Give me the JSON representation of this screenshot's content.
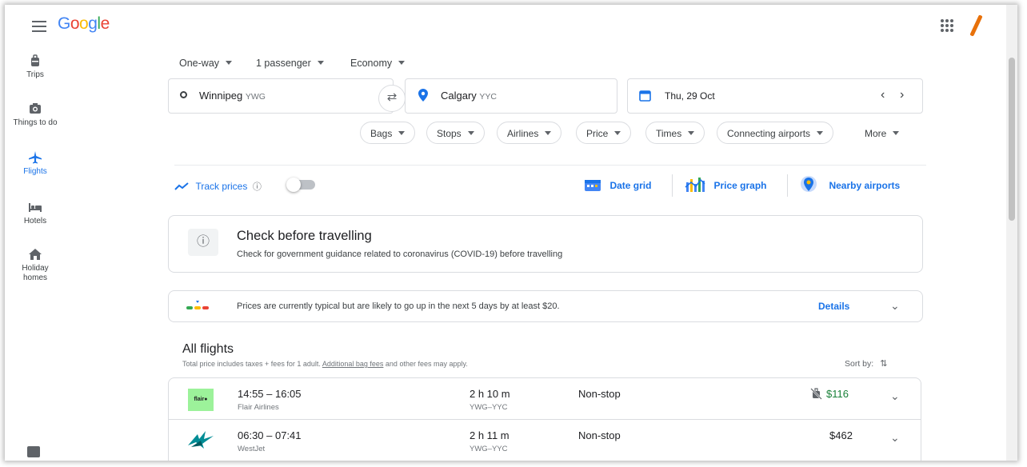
{
  "header": {
    "logo": "Google"
  },
  "sidebar": {
    "items": [
      {
        "label": "Trips",
        "icon": "trips-icon"
      },
      {
        "label": "Things to do",
        "icon": "camera-icon"
      },
      {
        "label": "Flights",
        "icon": "airplane-icon"
      },
      {
        "label": "Hotels",
        "icon": "bed-icon"
      },
      {
        "label": "Holiday homes",
        "icon": "house-icon"
      }
    ]
  },
  "search": {
    "trip_type": "One-way",
    "passengers": "1 passenger",
    "cabin": "Economy",
    "origin": "Winnipeg",
    "origin_code": "YWG",
    "destination": "Calgary",
    "destination_code": "YYC",
    "date": "Thu, 29 Oct"
  },
  "filters": [
    "Bags",
    "Stops",
    "Airlines",
    "Price",
    "Times",
    "Connecting airports",
    "More"
  ],
  "tools": {
    "track_prices": "Track prices",
    "date_grid": "Date grid",
    "price_graph": "Price graph",
    "nearby_airports": "Nearby airports"
  },
  "notice": {
    "title": "Check before travelling",
    "body": "Check for government guidance related to coronavirus (COVID-19) before travelling"
  },
  "insight": {
    "text": "Prices are currently typical but are likely to go up in the next 5 days by at least $20.",
    "details": "Details"
  },
  "results": {
    "heading": "All flights",
    "subtext_prefix": "Total price includes taxes + fees for 1 adult. ",
    "subtext_link": "Additional bag fees",
    "subtext_suffix": " and other fees may apply.",
    "sort_label": "Sort by:",
    "flights": [
      {
        "logo_text": "flair",
        "times": "14:55 – 16:05",
        "airline": "Flair Airlines",
        "duration": "2 h 10 m",
        "route": "YWG–YYC",
        "stops": "Non-stop",
        "price": "$116"
      },
      {
        "times": "06:30 – 07:41",
        "airline": "WestJet",
        "duration": "2 h 11 m",
        "route": "YWG–YYC",
        "stops": "Non-stop",
        "price": "$462"
      }
    ]
  },
  "colors": {
    "accent": "#1a73e8",
    "price_low": "#188038",
    "flair": "#9cf29a",
    "westjet": "#008c95"
  }
}
